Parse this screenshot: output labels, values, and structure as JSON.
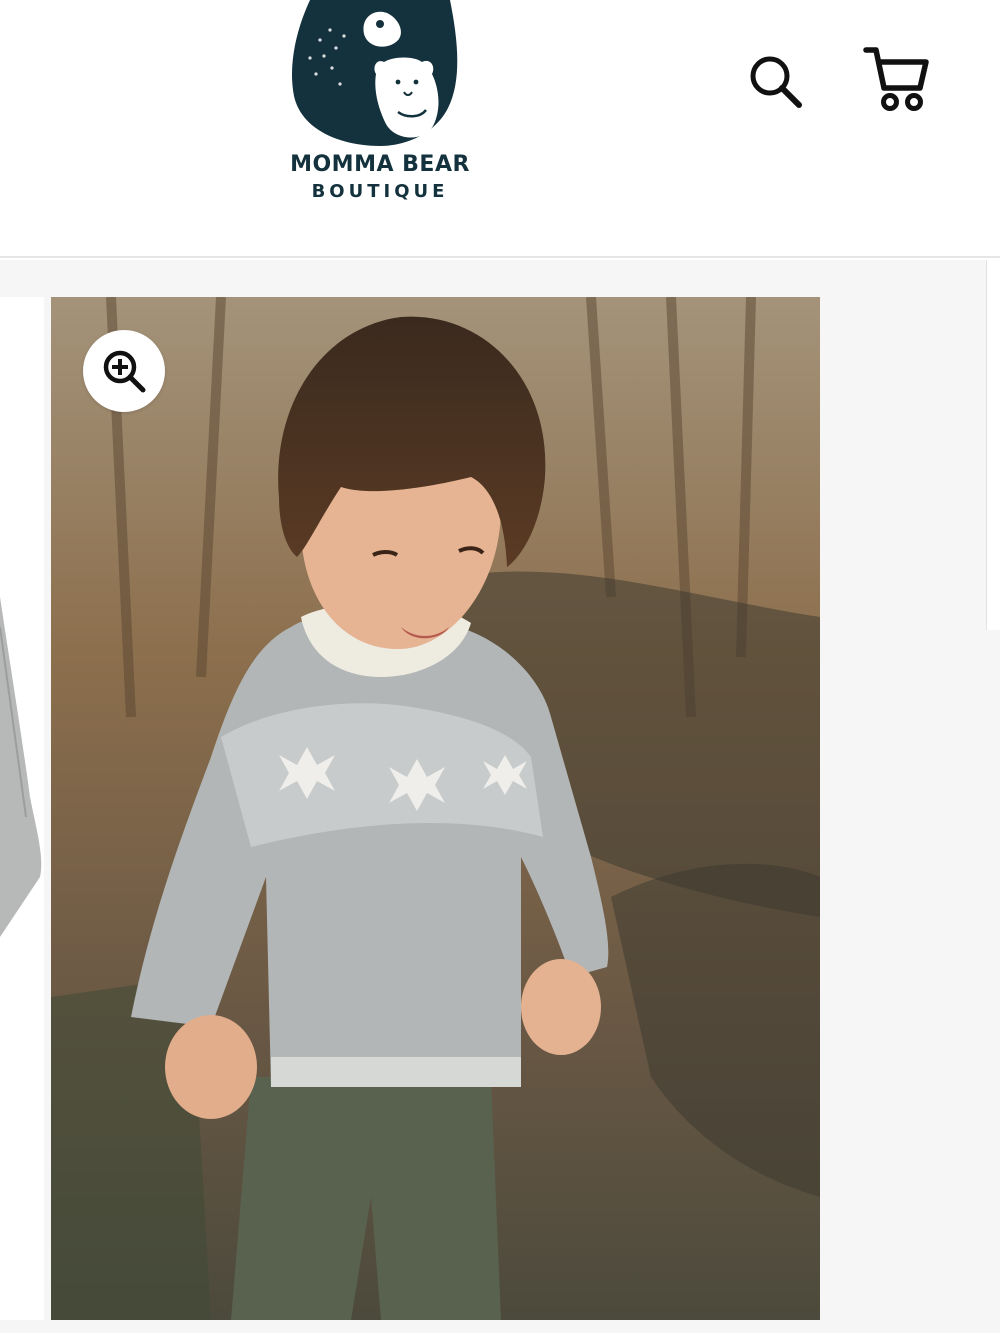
{
  "header": {
    "logo": {
      "line1": "MOMMA BEAR",
      "line2": "BOUTIQUE",
      "icon": "bear-mother-and-cub-logo"
    },
    "search_icon": "search-icon",
    "cart_icon": "cart-icon"
  },
  "product_gallery": {
    "zoom_icon": "zoom-in-icon",
    "main_image": {
      "subject": "toddler in gray fair isle snowflake sweater outdoors"
    },
    "previous_slide": {
      "subject": "gray sweater product photo (partially visible)"
    }
  },
  "colors": {
    "brand": "#14323d",
    "icon": "#111111",
    "background": "#f6f6f6"
  }
}
